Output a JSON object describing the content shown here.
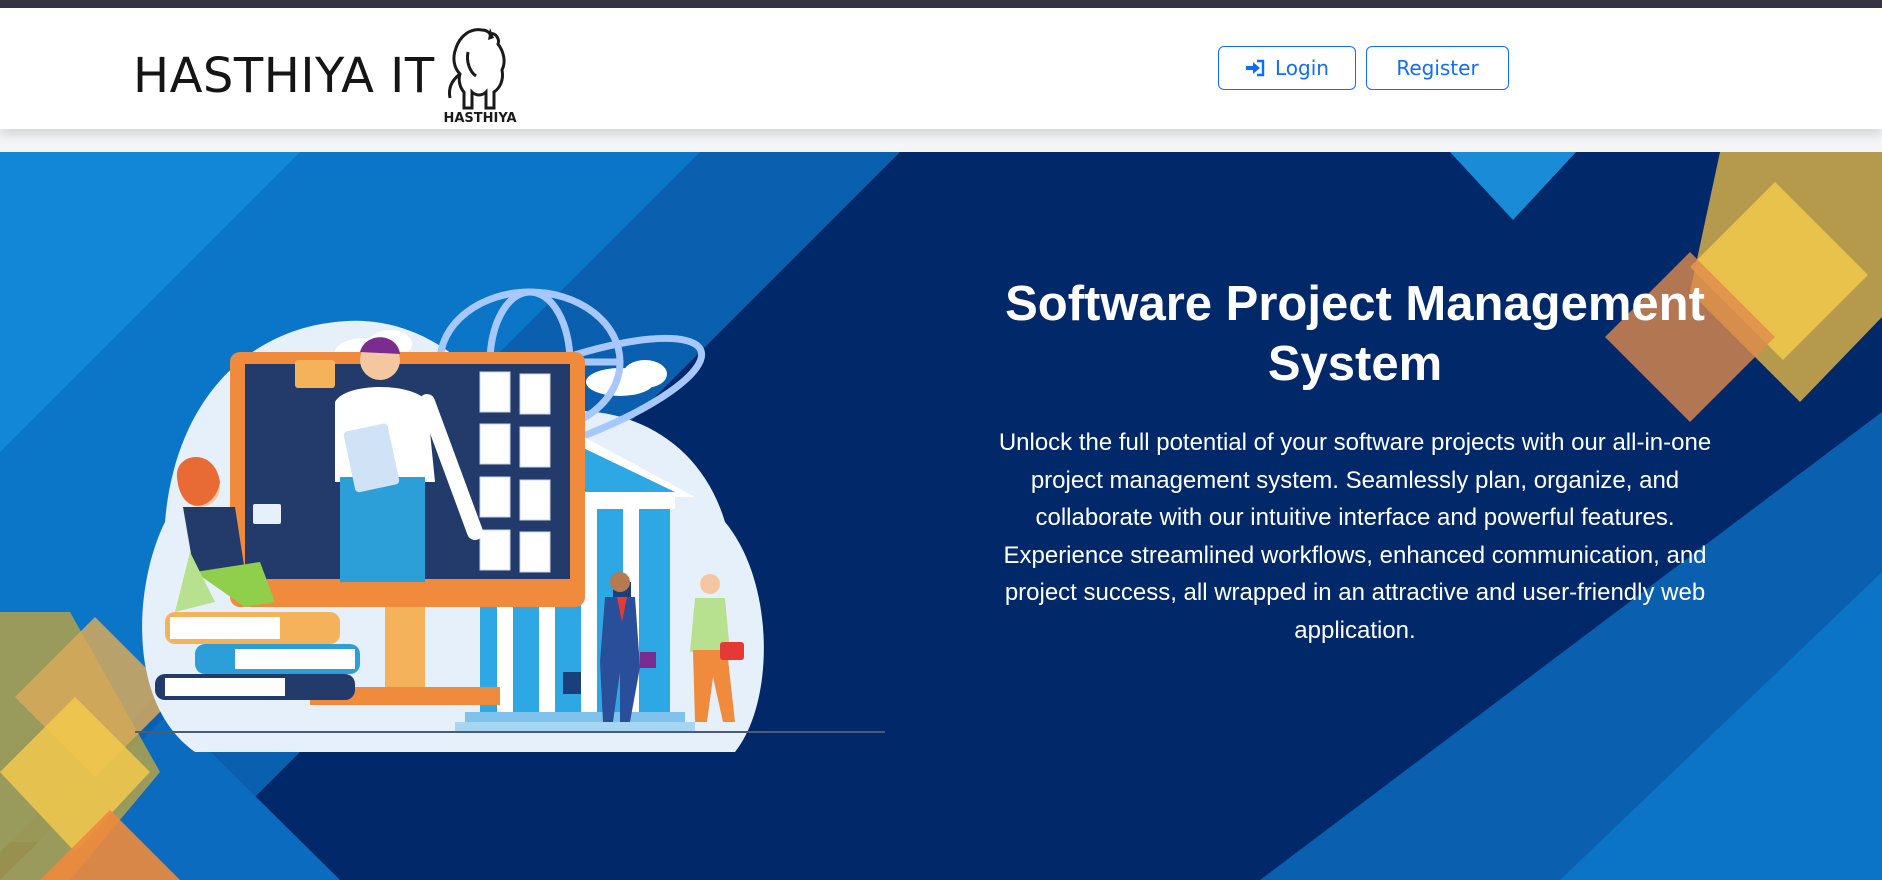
{
  "header": {
    "brand": "HASTHIYA IT",
    "logo_caption": "HASTHIYA",
    "login_label": "Login",
    "register_label": "Register",
    "login_icon": "sign-in-icon"
  },
  "hero": {
    "title": "Software Project Management System",
    "description": "Unlock the full potential of your software projects with our all-in-one project management system. Seamlessly plan, organize, and collaborate with our intuitive interface and powerful features. Experience streamlined workflows, enhanced communication, and project success, all wrapped in an attractive and user-friendly web application."
  },
  "colors": {
    "primary": "#0d6efd",
    "hero_bg": "#012868",
    "accent_blue": "#0a72c9",
    "accent_yellow": "#f4c542",
    "accent_orange": "#f08a3c"
  }
}
